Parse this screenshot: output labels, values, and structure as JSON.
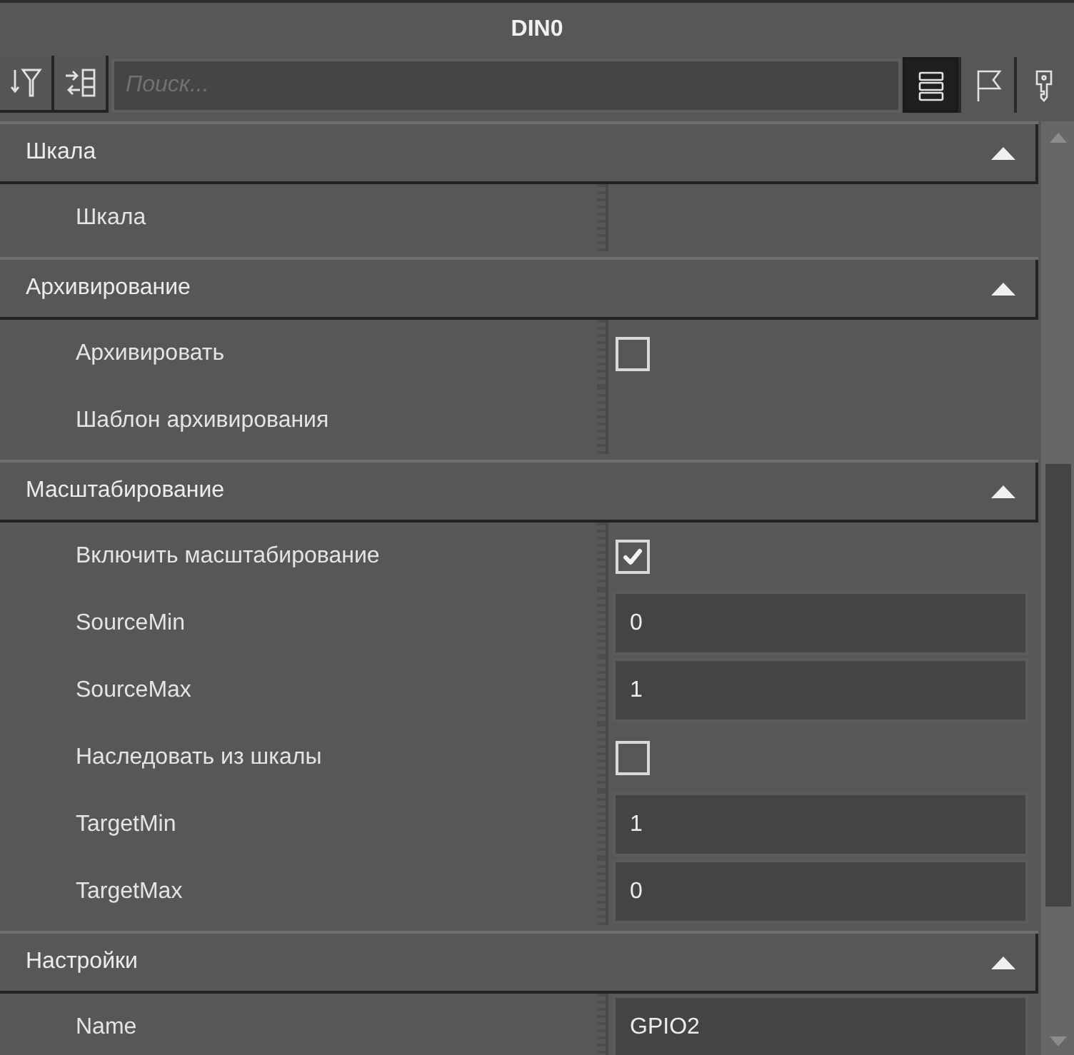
{
  "window": {
    "title": "DIN0"
  },
  "toolbar": {
    "search": {
      "placeholder": "Поиск..."
    },
    "view_buttons": [
      {
        "selected": true
      },
      {
        "selected": false
      },
      {
        "selected": false
      }
    ]
  },
  "categories": [
    {
      "title": "Шкала",
      "expanded": true,
      "properties": [
        {
          "label": "Шкала",
          "kind": "empty"
        }
      ]
    },
    {
      "title": "Архивирование",
      "expanded": true,
      "properties": [
        {
          "label": "Архивировать",
          "kind": "checkbox",
          "checked": false
        },
        {
          "label": "Шаблон архивирования",
          "kind": "empty"
        }
      ]
    },
    {
      "title": "Масштабирование",
      "expanded": true,
      "properties": [
        {
          "label": "Включить масштабирование",
          "kind": "checkbox",
          "checked": true
        },
        {
          "label": "SourceMin",
          "kind": "text",
          "value": "0"
        },
        {
          "label": "SourceMax",
          "kind": "text",
          "value": "1"
        },
        {
          "label": "Наследовать из шкалы",
          "kind": "checkbox",
          "checked": false
        },
        {
          "label": "TargetMin",
          "kind": "text",
          "value": "1"
        },
        {
          "label": "TargetMax",
          "kind": "text",
          "value": "0"
        }
      ]
    },
    {
      "title": "Настройки",
      "expanded": true,
      "properties": [
        {
          "label": "Name",
          "kind": "text",
          "value": "GPIO2"
        }
      ]
    }
  ]
}
